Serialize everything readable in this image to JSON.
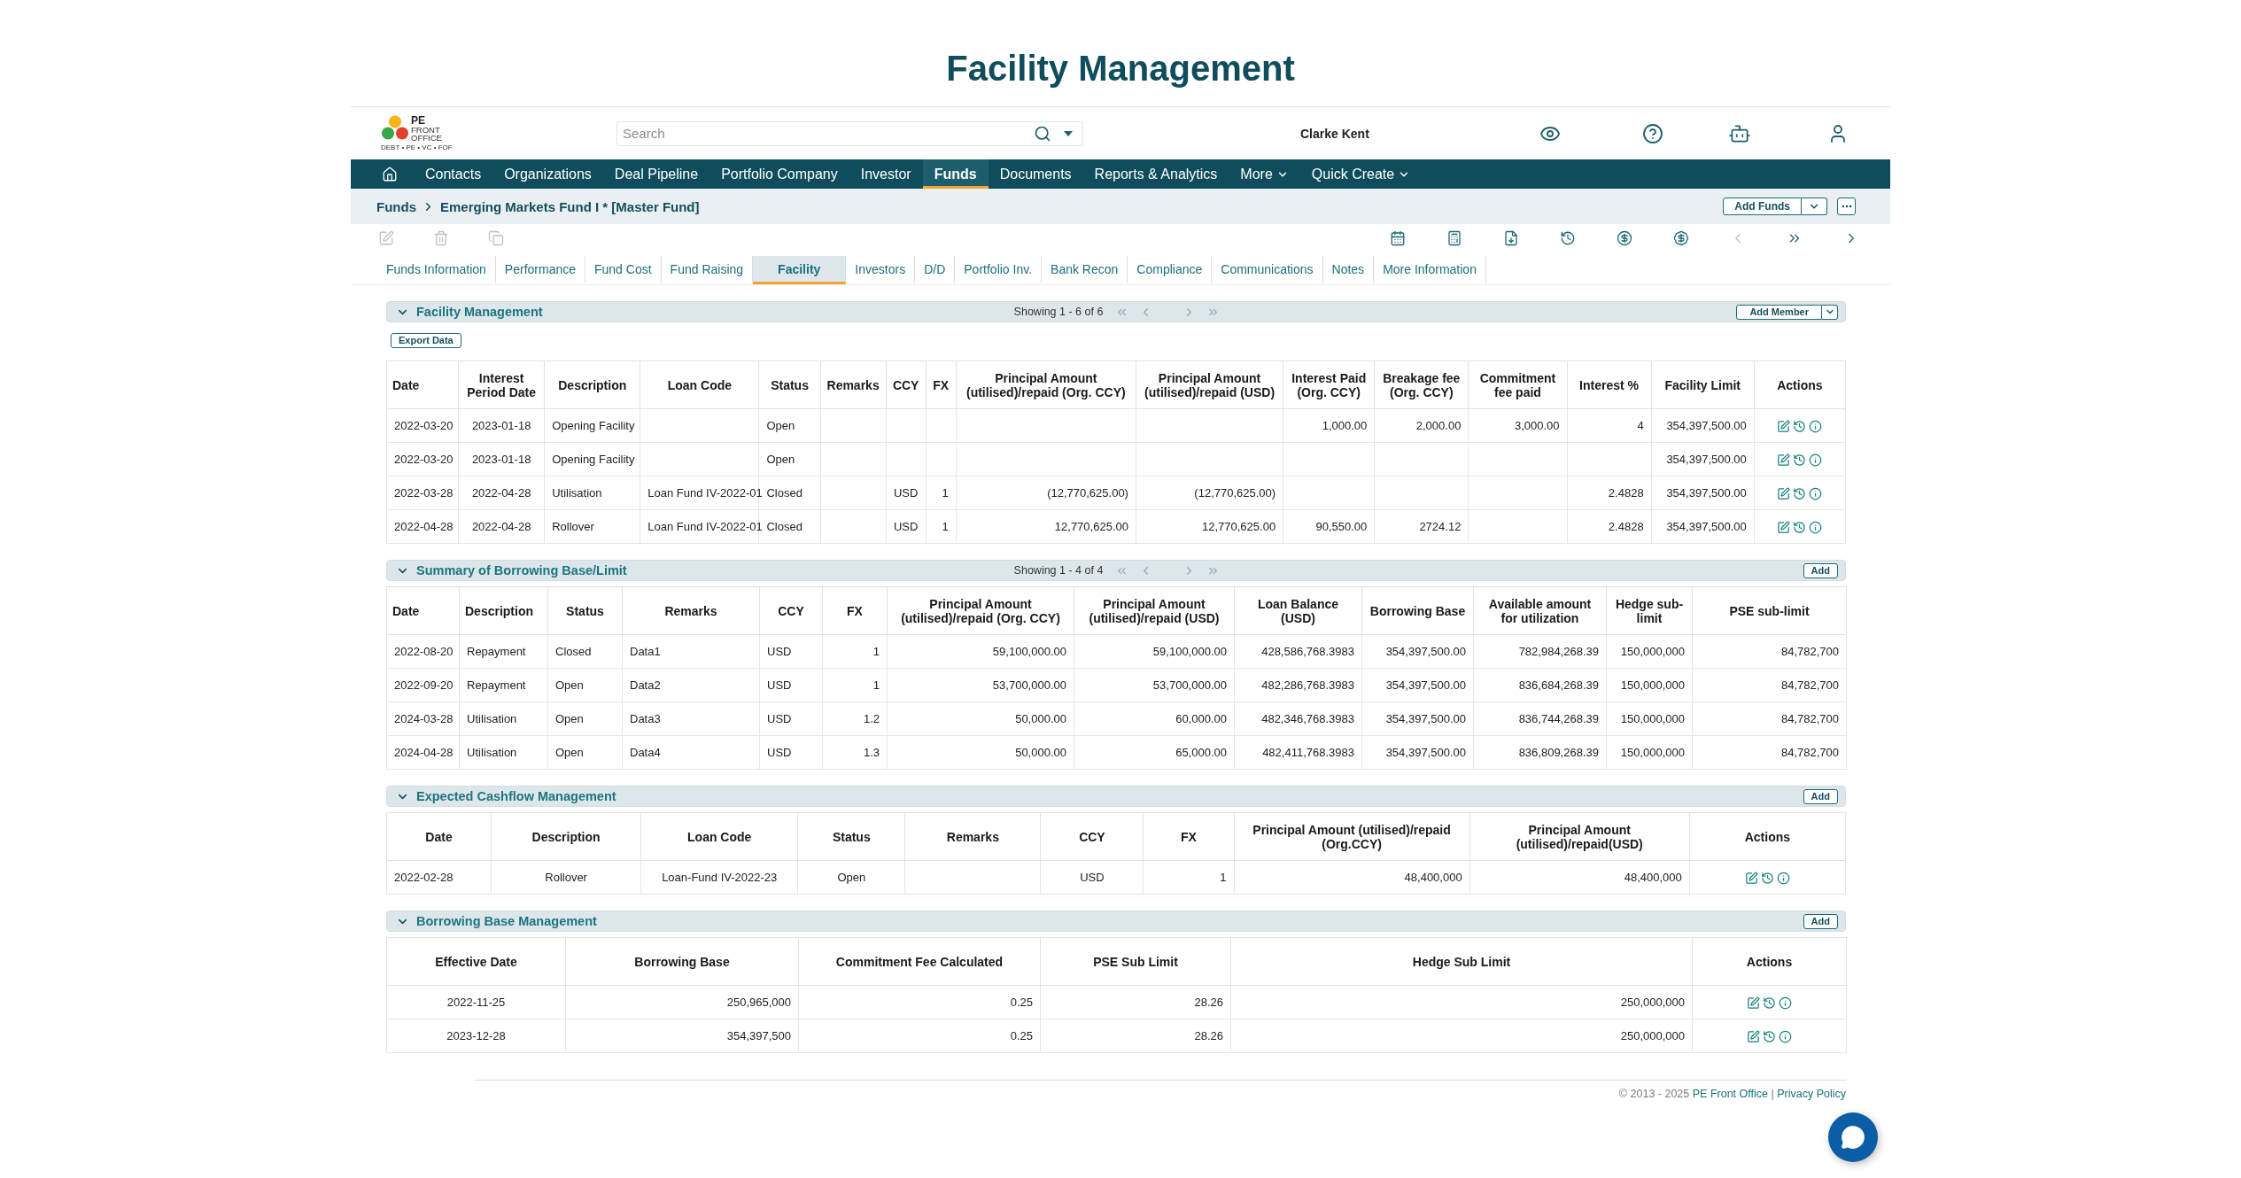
{
  "page_title": "Facility Management",
  "logo": {
    "title": "PE",
    "name_lines": [
      "FRONT",
      "OFFICE"
    ],
    "tagline": "DEBT • PE • VC • FOF"
  },
  "search": {
    "placeholder": "Search"
  },
  "user": {
    "name": "Clarke Kent"
  },
  "nav": {
    "items": [
      {
        "label": "Contacts",
        "selected": false,
        "has_menu": false
      },
      {
        "label": "Organizations",
        "selected": false,
        "has_menu": false
      },
      {
        "label": "Deal Pipeline",
        "selected": false,
        "has_menu": false
      },
      {
        "label": "Portfolio Company",
        "selected": false,
        "has_menu": false
      },
      {
        "label": "Investor",
        "selected": false,
        "has_menu": false
      },
      {
        "label": "Funds",
        "selected": true,
        "has_menu": false
      },
      {
        "label": "Documents",
        "selected": false,
        "has_menu": false
      },
      {
        "label": "Reports & Analytics",
        "selected": false,
        "has_menu": false
      },
      {
        "label": "More",
        "selected": false,
        "has_menu": true
      },
      {
        "label": "Quick Create",
        "selected": false,
        "has_menu": true
      }
    ]
  },
  "breadcrumb": {
    "items": [
      "Funds",
      "Emerging Markets Fund I * [Master Fund]"
    ],
    "button": "Add Funds"
  },
  "toolbar": {
    "record_tools": [
      {
        "disabled": true
      },
      {
        "disabled": true
      },
      {
        "disabled": true
      }
    ],
    "view_tools": [
      {
        "disabled": false
      },
      {
        "disabled": false
      },
      {
        "disabled": false
      },
      {
        "disabled": false
      },
      {
        "disabled": false
      },
      {
        "disabled": false
      },
      {
        "disabled": true
      },
      {
        "disabled": false
      },
      {
        "disabled": false
      }
    ]
  },
  "tabs": [
    {
      "label": "Funds Information",
      "selected": false
    },
    {
      "label": "Performance",
      "selected": false
    },
    {
      "label": "Fund Cost",
      "selected": false
    },
    {
      "label": "Fund Raising",
      "selected": false
    },
    {
      "label": "Facility",
      "selected": true
    },
    {
      "label": "Investors",
      "selected": false
    },
    {
      "label": "D/D",
      "selected": false
    },
    {
      "label": "Portfolio Inv.",
      "selected": false
    },
    {
      "label": "Bank Recon",
      "selected": false
    },
    {
      "label": "Compliance",
      "selected": false
    },
    {
      "label": "Communications",
      "selected": false
    },
    {
      "label": "Notes",
      "selected": false
    },
    {
      "label": "More Information",
      "selected": false
    }
  ],
  "sections": [
    {
      "title": "Facility Management",
      "expanded": true,
      "pager": {
        "text": "Showing 1 - 6 of 6"
      },
      "action_button": {
        "label": "Add Member",
        "kind": "split"
      },
      "export_button": "Export Data",
      "table": {
        "columns": [
          {
            "label": "Date",
            "kind": "text"
          },
          {
            "label": "Interest Period Date",
            "kind": "text"
          },
          {
            "label": "Description",
            "kind": "text"
          },
          {
            "label": "Loan Code",
            "kind": "text"
          },
          {
            "label": "Status",
            "kind": "text"
          },
          {
            "label": "Remarks",
            "kind": "text"
          },
          {
            "label": "CCY",
            "kind": "text"
          },
          {
            "label": "FX",
            "kind": "text"
          },
          {
            "label": "Principal Amount (utilised)/repaid (Org. CCY)",
            "kind": "text"
          },
          {
            "label": "Principal Amount (utilised)/repaid (USD)",
            "kind": "text"
          },
          {
            "label": "Interest Paid (Org. CCY)",
            "kind": "text"
          },
          {
            "label": "Breakage fee (Org. CCY)",
            "kind": "text"
          },
          {
            "label": "Commitment fee paid",
            "kind": "text"
          },
          {
            "label": "Interest %",
            "kind": "text"
          },
          {
            "label": "Facility Limit",
            "kind": "text"
          },
          {
            "label": "Actions",
            "kind": "actions"
          }
        ],
        "rows": [
          [
            "2022-03-20",
            "2023-01-18",
            "Opening Facility",
            null,
            "Open",
            null,
            null,
            null,
            null,
            null,
            "1,000.00",
            "2,000.00",
            "3,000.00",
            "4",
            "354,397,500.00"
          ],
          [
            "2022-03-20",
            "2023-01-18",
            "Opening Facility",
            null,
            "Open",
            null,
            null,
            null,
            null,
            null,
            null,
            null,
            null,
            null,
            "354,397,500.00"
          ],
          [
            "2022-03-28",
            "2022-04-28",
            "Utilisation",
            "Loan Fund IV-2022-01",
            "Closed",
            null,
            "USD",
            "1",
            "(12,770,625.00)",
            "(12,770,625.00)",
            null,
            null,
            null,
            "2.4828",
            "354,397,500.00"
          ],
          [
            "2022-04-28",
            "2022-04-28",
            "Rollover",
            "Loan Fund IV-2022-01",
            "Closed",
            null,
            "USD",
            "1",
            "12,770,625.00",
            "12,770,625.00",
            "90,550.00",
            "2724.12",
            null,
            "2.4828",
            "354,397,500.00"
          ]
        ]
      }
    },
    {
      "title": "Summary of Borrowing Base/Limit",
      "expanded": true,
      "pager": {
        "text": "Showing 1 - 4 of 4"
      },
      "action_button": {
        "label": "Add",
        "kind": "plain"
      },
      "table": {
        "columns": [
          {
            "label": "Date",
            "kind": "text"
          },
          {
            "label": "Description",
            "kind": "text"
          },
          {
            "label": "Status",
            "kind": "text"
          },
          {
            "label": "Remarks",
            "kind": "text"
          },
          {
            "label": "CCY",
            "kind": "text"
          },
          {
            "label": "FX",
            "kind": "text"
          },
          {
            "label": "Principal Amount (utilised)/repaid (Org. CCY)",
            "kind": "text"
          },
          {
            "label": "Principal Amount (utilised)/repaid (USD)",
            "kind": "text"
          },
          {
            "label": "Loan Balance (USD)",
            "kind": "text"
          },
          {
            "label": "Borrowing Base",
            "kind": "text"
          },
          {
            "label": "Available amount for utilization",
            "kind": "text"
          },
          {
            "label": "Hedge sub-limit",
            "kind": "text"
          },
          {
            "label": "PSE sub-limit",
            "kind": "text"
          }
        ],
        "rows": [
          [
            "2022-08-20",
            "Repayment",
            "Closed",
            "Data1",
            "USD",
            "1",
            "59,100,000.00",
            "59,100,000.00",
            "428,586,768.3983",
            "354,397,500.00",
            "782,984,268.39",
            "150,000,000",
            "84,782,700"
          ],
          [
            "2022-09-20",
            "Repayment",
            "Open",
            "Data2",
            "USD",
            "1",
            "53,700,000.00",
            "53,700,000.00",
            "482,286,768.3983",
            "354,397,500.00",
            "836,684,268.39",
            "150,000,000",
            "84,782,700"
          ],
          [
            "2024-03-28",
            "Utilisation",
            "Open",
            "Data3",
            "USD",
            "1.2",
            "50,000.00",
            "60,000.00",
            "482,346,768.3983",
            "354,397,500.00",
            "836,744,268.39",
            "150,000,000",
            "84,782,700"
          ],
          [
            "2024-04-28",
            "Utilisation",
            "Open",
            "Data4",
            "USD",
            "1.3",
            "50,000.00",
            "65,000.00",
            "482,411,768.3983",
            "354,397,500.00",
            "836,809,268.39",
            "150,000,000",
            "84,782,700"
          ]
        ]
      }
    },
    {
      "title": "Expected Cashflow Management",
      "expanded": true,
      "action_button": {
        "label": "Add",
        "kind": "plain"
      },
      "table": {
        "columns": [
          {
            "label": "Date",
            "kind": "text"
          },
          {
            "label": "Description",
            "kind": "text"
          },
          {
            "label": "Loan Code",
            "kind": "text"
          },
          {
            "label": "Status",
            "kind": "text"
          },
          {
            "label": "Remarks",
            "kind": "text"
          },
          {
            "label": "CCY",
            "kind": "text"
          },
          {
            "label": "FX",
            "kind": "text"
          },
          {
            "label": "Principal Amount (utilised)/repaid (Org.CCY)",
            "kind": "text"
          },
          {
            "label": "Principal Amount (utilised)/repaid(USD)",
            "kind": "text"
          },
          {
            "label": "Actions",
            "kind": "actions"
          }
        ],
        "rows": [
          [
            "2022-02-28",
            "Rollover",
            "Loan-Fund IV-2022-23",
            "Open",
            null,
            "USD",
            "1",
            "48,400,000",
            "48,400,000"
          ]
        ]
      }
    },
    {
      "title": "Borrowing Base Management",
      "expanded": true,
      "action_button": {
        "label": "Add",
        "kind": "plain"
      },
      "table": {
        "columns": [
          {
            "label": "Effective Date",
            "kind": "text"
          },
          {
            "label": "Borrowing Base",
            "kind": "text"
          },
          {
            "label": "Commitment Fee Calculated",
            "kind": "text"
          },
          {
            "label": "PSE Sub Limit",
            "kind": "text"
          },
          {
            "label": "Hedge Sub Limit",
            "kind": "text"
          },
          {
            "label": "Actions",
            "kind": "actions"
          }
        ],
        "rows": [
          [
            "2022-11-25",
            "250,965,000",
            "0.25",
            "28.26",
            "250,000,000"
          ],
          [
            "2023-12-28",
            "354,397,500",
            "0.25",
            "28.26",
            "250,000,000"
          ]
        ]
      }
    }
  ],
  "footer": {
    "copyright": "© 2013 - 2025",
    "company_link": "PE Front Office",
    "separator": "|",
    "policy_link": "Privacy Policy"
  }
}
